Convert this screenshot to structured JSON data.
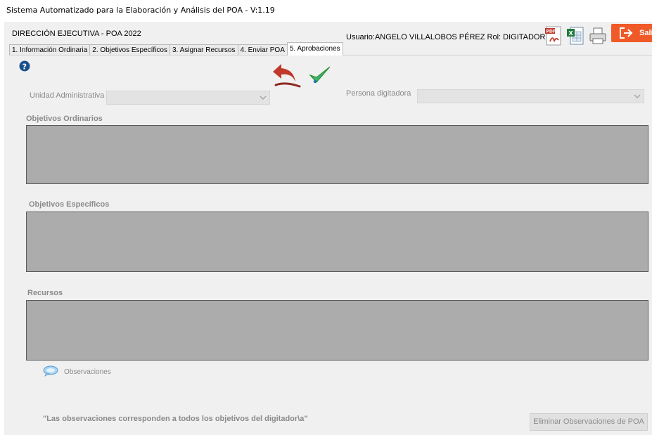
{
  "window": {
    "title": "Sistema Automatizado para la Elaboración y Análisis del POA -  V:1.19"
  },
  "header": {
    "department": "DIRECCIÓN EJECUTIVA - POA 2022",
    "user_info": "Usuario:ANGELO VILLALOBOS PÉREZ  Rol: DIGITADOR",
    "exit_label": "Sali"
  },
  "toolbar": {
    "icons": [
      "pdf-icon",
      "excel-icon",
      "printer-icon",
      "exit-icon"
    ]
  },
  "tabs": [
    {
      "label": "1. Información Ordinaria"
    },
    {
      "label": "2. Objetivos Específicos"
    },
    {
      "label": "3. Asignar Recursos"
    },
    {
      "label": "4. Enviar POA"
    },
    {
      "label": "5. Aprobaciones",
      "active": true
    }
  ],
  "form": {
    "unidad_label": "Unidad Administrativa",
    "unidad_value": "",
    "persona_label": "Persona digitadora",
    "persona_value": ""
  },
  "sections": {
    "ordinarios": "Objetivos Ordinarios",
    "especificos": "Objetivos Específicos",
    "recursos": "Recursos"
  },
  "observaciones": {
    "label": "Observaciones",
    "note": "\"Las observaciones corresponden a todos los objetivos del digitador\\a\"",
    "delete_button": "Eliminar Observaciones de POA"
  },
  "colors": {
    "exit_button": "#f05a28",
    "grid_background": "#acacac",
    "disabled_text": "#8a8a8a",
    "help_icon": "#1a4f8c",
    "undo_arrow": "#c0392b",
    "check_mark": "#3cb371"
  }
}
